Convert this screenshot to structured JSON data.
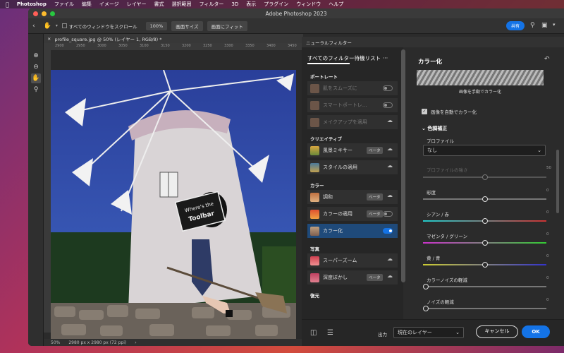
{
  "menubar": {
    "app": "Photoshop",
    "items": [
      "ファイル",
      "編集",
      "イメージ",
      "レイヤー",
      "書式",
      "選択範囲",
      "フィルター",
      "3D",
      "表示",
      "プラグイン",
      "ウィンドウ",
      "ヘルプ"
    ]
  },
  "window": {
    "title": "Adobe Photoshop 2023"
  },
  "options": {
    "scroll_all": "すべてのウィンドウをスクロール",
    "zoom": "100%",
    "fit_screen": "画面サイズ",
    "fill_screen": "画面にフィット",
    "share": "共有"
  },
  "document": {
    "tab": "profile_square.jpg @ 50% (レイヤー 1, RGB/8) *",
    "ruler_ticks": [
      "2900",
      "2950",
      "3000",
      "3050",
      "3100",
      "3150",
      "3200",
      "3250",
      "3300",
      "3350",
      "3400",
      "3450"
    ],
    "zoom": "50%",
    "size": "2980 px x 2980 px (72 ppi)",
    "sign_text_1": "Where's the",
    "sign_text_2": "Toolbar"
  },
  "neural": {
    "panel_tab": "ニューラルフィルター",
    "tab_all": "すべてのフィルター",
    "tab_wait": "待機リスト",
    "more": "···",
    "categories": {
      "portrait": "ポートレート",
      "creative": "クリエイティブ",
      "color": "カラー",
      "photo": "写真",
      "restore": "復元"
    },
    "filters": {
      "skin": "肌をスムーズに",
      "smart": "スマートポートレ…",
      "makeup": "メイクアップを適用",
      "landscape": "風景ミキサー",
      "style": "スタイルの適用",
      "harmonize": "調和",
      "color_transfer": "カラーの適用",
      "colorize": "カラー化",
      "superzoom": "スーパーズーム",
      "depth": "深度ぼかし"
    },
    "beta": "ベータ"
  },
  "right": {
    "title": "カラー化",
    "caption": "画像を手動でカラー化",
    "auto_color": "画像を自動でカラー化",
    "section": "色調補正",
    "profile_label": "プロファイル",
    "profile_value": "なし",
    "profile_strength": "プロファイルの強さ",
    "profile_strength_val": "50",
    "saturation": "彩度",
    "cyan_red": "シアン / 赤",
    "magenta_green": "マゼンタ / グリーン",
    "yellow_blue": "黄 / 青",
    "color_noise": "カラーノイズの軽減",
    "noise": "ノイズの軽減",
    "zero": "0"
  },
  "bottom": {
    "output_label": "出力",
    "output_value": "現在のレイヤー",
    "cancel": "キャンセル",
    "ok": "OK"
  },
  "colors": {
    "accent": "#1473e6",
    "panel": "#2b2b2b",
    "active_item": "#1f4a7a"
  }
}
